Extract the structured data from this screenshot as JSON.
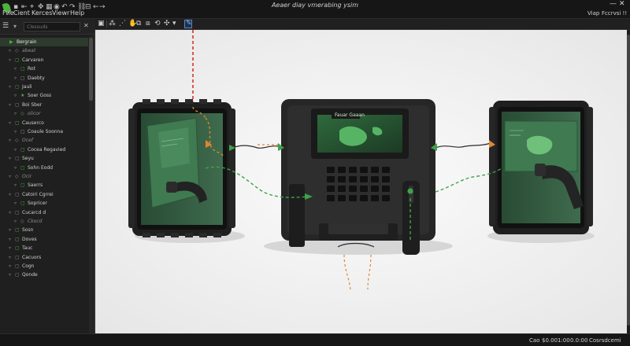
{
  "menu": {
    "items": [
      "Fие",
      "Cient",
      "Kerces",
      "Viewr",
      "Help"
    ]
  },
  "window": {
    "title": "Aeaer diay vmerabing ysim",
    "min": "—",
    "close": "✕"
  },
  "top_right": {
    "label_a": "Viap",
    "label_b": "Fccrvsi !!"
  },
  "panel": {
    "search_placeholder": "Clessuds",
    "tree": [
      "Bergrain",
      "abeat",
      "Carvaren",
      "Rot",
      "Daebty",
      "Jauli",
      "Soer Goss",
      "Boi Sber",
      "olicor",
      "Causerco",
      "Coaule Soonna",
      "Ocef",
      "Cocea Regavied",
      "Seyu",
      "Sohn Eodd",
      "Ocir",
      "Saerrs",
      "Catoiri Cgrrei",
      "Sopricer",
      "Cucarcd d",
      "Ckocd",
      "Sosn",
      "Doves",
      "Tauc",
      "Cacuors",
      "Cogn",
      "Qonde"
    ]
  },
  "viewport": {
    "screen_title": "Fauar Gaaan"
  },
  "status": {
    "a": "Cao",
    "b": "$0.00",
    "c": "1:00",
    "d": "0.0:00",
    "e": "Cosrsdcemi"
  }
}
